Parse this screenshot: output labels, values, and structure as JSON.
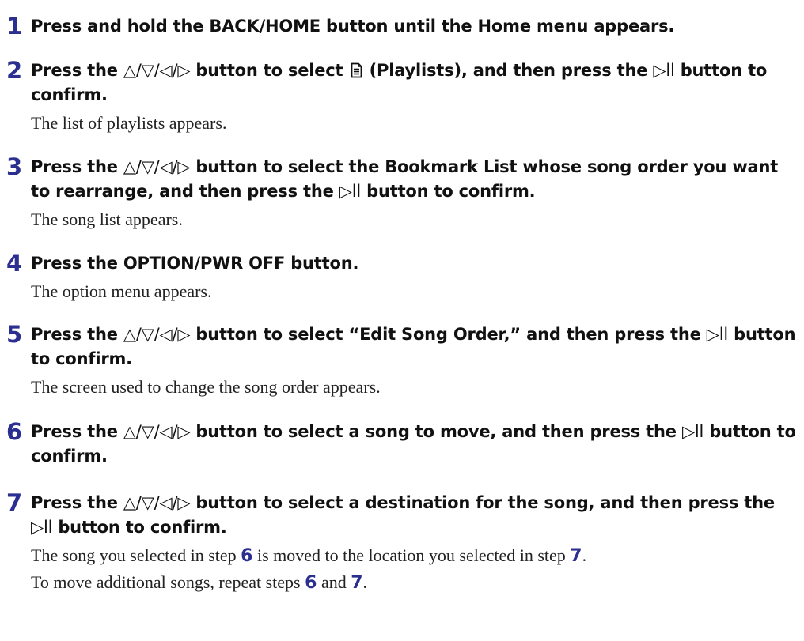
{
  "steps": [
    {
      "number": "1",
      "title": "Press and hold the BACK/HOME button until the Home menu appears."
    },
    {
      "number": "2",
      "title_part1": "Press the ",
      "nav_symbols": "△/▽/◁/▷",
      "title_part2": " button to select ",
      "icon_name": "playlist-icon",
      "title_part3": " (Playlists), and then press the ",
      "play_symbol": "▷ll",
      "title_part4": " button to confirm.",
      "body": "The list of playlists appears."
    },
    {
      "number": "3",
      "title_part1": "Press the ",
      "nav_symbols": "△/▽/◁/▷",
      "title_part2": " button to select the Bookmark List whose song order you want to rearrange, and then press the ",
      "play_symbol": "▷ll",
      "title_part3": " button to confirm.",
      "body": "The song list appears."
    },
    {
      "number": "4",
      "title": "Press the OPTION/PWR OFF button.",
      "body": "The option menu appears."
    },
    {
      "number": "5",
      "title_part1": "Press the ",
      "nav_symbols": "△/▽/◁/▷",
      "title_part2": " button to select “Edit Song Order,” and then press the ",
      "play_symbol": "▷ll",
      "title_part3": " button to confirm.",
      "body": "The screen used to change the song order appears."
    },
    {
      "number": "6",
      "title_part1": "Press the ",
      "nav_symbols": "△/▽/◁/▷",
      "title_part2": " button to select a song to move, and then press the ",
      "play_symbol": "▷ll",
      "title_part3": " button to confirm."
    },
    {
      "number": "7",
      "title_part1": "Press the ",
      "nav_symbols": "△/▽/◁/▷",
      "title_part2": " button to select a destination for the song, and then press the ",
      "play_symbol": "▷ll",
      "title_part3": " button to confirm.",
      "body_line1_part1": "The song you selected in step ",
      "body_line1_ref1": "6",
      "body_line1_part2": " is moved to the location you selected in step ",
      "body_line1_ref2": "7",
      "body_line1_part3": ".",
      "body_line2_part1": "To move additional songs, repeat steps ",
      "body_line2_ref1": "6",
      "body_line2_part2": " and ",
      "body_line2_ref2": "7",
      "body_line2_part3": "."
    }
  ],
  "colors": {
    "step_number": "#2b2f8f",
    "heading_text": "#111111",
    "body_text": "#222222"
  }
}
